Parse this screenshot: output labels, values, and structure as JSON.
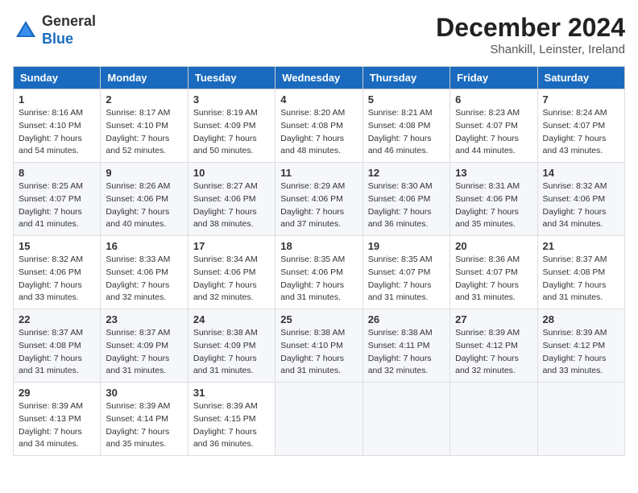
{
  "header": {
    "logo": {
      "line1": "General",
      "line2": "Blue"
    },
    "title": "December 2024",
    "location": "Shankill, Leinster, Ireland"
  },
  "weekdays": [
    "Sunday",
    "Monday",
    "Tuesday",
    "Wednesday",
    "Thursday",
    "Friday",
    "Saturday"
  ],
  "weeks": [
    [
      {
        "day": 1,
        "sunrise": "8:16 AM",
        "sunset": "4:10 PM",
        "daylight": "7 hours and 54 minutes."
      },
      {
        "day": 2,
        "sunrise": "8:17 AM",
        "sunset": "4:10 PM",
        "daylight": "7 hours and 52 minutes."
      },
      {
        "day": 3,
        "sunrise": "8:19 AM",
        "sunset": "4:09 PM",
        "daylight": "7 hours and 50 minutes."
      },
      {
        "day": 4,
        "sunrise": "8:20 AM",
        "sunset": "4:08 PM",
        "daylight": "7 hours and 48 minutes."
      },
      {
        "day": 5,
        "sunrise": "8:21 AM",
        "sunset": "4:08 PM",
        "daylight": "7 hours and 46 minutes."
      },
      {
        "day": 6,
        "sunrise": "8:23 AM",
        "sunset": "4:07 PM",
        "daylight": "7 hours and 44 minutes."
      },
      {
        "day": 7,
        "sunrise": "8:24 AM",
        "sunset": "4:07 PM",
        "daylight": "7 hours and 43 minutes."
      }
    ],
    [
      {
        "day": 8,
        "sunrise": "8:25 AM",
        "sunset": "4:07 PM",
        "daylight": "7 hours and 41 minutes."
      },
      {
        "day": 9,
        "sunrise": "8:26 AM",
        "sunset": "4:06 PM",
        "daylight": "7 hours and 40 minutes."
      },
      {
        "day": 10,
        "sunrise": "8:27 AM",
        "sunset": "4:06 PM",
        "daylight": "7 hours and 38 minutes."
      },
      {
        "day": 11,
        "sunrise": "8:29 AM",
        "sunset": "4:06 PM",
        "daylight": "7 hours and 37 minutes."
      },
      {
        "day": 12,
        "sunrise": "8:30 AM",
        "sunset": "4:06 PM",
        "daylight": "7 hours and 36 minutes."
      },
      {
        "day": 13,
        "sunrise": "8:31 AM",
        "sunset": "4:06 PM",
        "daylight": "7 hours and 35 minutes."
      },
      {
        "day": 14,
        "sunrise": "8:32 AM",
        "sunset": "4:06 PM",
        "daylight": "7 hours and 34 minutes."
      }
    ],
    [
      {
        "day": 15,
        "sunrise": "8:32 AM",
        "sunset": "4:06 PM",
        "daylight": "7 hours and 33 minutes."
      },
      {
        "day": 16,
        "sunrise": "8:33 AM",
        "sunset": "4:06 PM",
        "daylight": "7 hours and 32 minutes."
      },
      {
        "day": 17,
        "sunrise": "8:34 AM",
        "sunset": "4:06 PM",
        "daylight": "7 hours and 32 minutes."
      },
      {
        "day": 18,
        "sunrise": "8:35 AM",
        "sunset": "4:06 PM",
        "daylight": "7 hours and 31 minutes."
      },
      {
        "day": 19,
        "sunrise": "8:35 AM",
        "sunset": "4:07 PM",
        "daylight": "7 hours and 31 minutes."
      },
      {
        "day": 20,
        "sunrise": "8:36 AM",
        "sunset": "4:07 PM",
        "daylight": "7 hours and 31 minutes."
      },
      {
        "day": 21,
        "sunrise": "8:37 AM",
        "sunset": "4:08 PM",
        "daylight": "7 hours and 31 minutes."
      }
    ],
    [
      {
        "day": 22,
        "sunrise": "8:37 AM",
        "sunset": "4:08 PM",
        "daylight": "7 hours and 31 minutes."
      },
      {
        "day": 23,
        "sunrise": "8:37 AM",
        "sunset": "4:09 PM",
        "daylight": "7 hours and 31 minutes."
      },
      {
        "day": 24,
        "sunrise": "8:38 AM",
        "sunset": "4:09 PM",
        "daylight": "7 hours and 31 minutes."
      },
      {
        "day": 25,
        "sunrise": "8:38 AM",
        "sunset": "4:10 PM",
        "daylight": "7 hours and 31 minutes."
      },
      {
        "day": 26,
        "sunrise": "8:38 AM",
        "sunset": "4:11 PM",
        "daylight": "7 hours and 32 minutes."
      },
      {
        "day": 27,
        "sunrise": "8:39 AM",
        "sunset": "4:12 PM",
        "daylight": "7 hours and 32 minutes."
      },
      {
        "day": 28,
        "sunrise": "8:39 AM",
        "sunset": "4:12 PM",
        "daylight": "7 hours and 33 minutes."
      }
    ],
    [
      {
        "day": 29,
        "sunrise": "8:39 AM",
        "sunset": "4:13 PM",
        "daylight": "7 hours and 34 minutes."
      },
      {
        "day": 30,
        "sunrise": "8:39 AM",
        "sunset": "4:14 PM",
        "daylight": "7 hours and 35 minutes."
      },
      {
        "day": 31,
        "sunrise": "8:39 AM",
        "sunset": "4:15 PM",
        "daylight": "7 hours and 36 minutes."
      },
      null,
      null,
      null,
      null
    ]
  ]
}
